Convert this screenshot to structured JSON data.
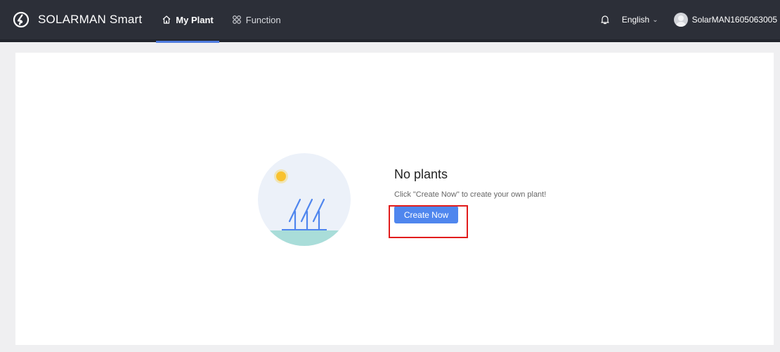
{
  "header": {
    "app_name": "SOLARMAN Smart",
    "logo_icon": "solarman-logo-icon",
    "nav": [
      {
        "label": "My Plant",
        "icon": "home-icon",
        "active": true
      },
      {
        "label": "Function",
        "icon": "grid-icon",
        "active": false
      }
    ],
    "notifications_icon": "bell-icon",
    "language": "English",
    "user": "SolarMAN1605063005"
  },
  "main": {
    "empty_state": {
      "illustration": "solar-panels-illustration",
      "title": "No plants",
      "description": "Click \"Create Now\" to create your own plant!",
      "button_label": "Create Now"
    }
  },
  "colors": {
    "header_bg": "#2c2f38",
    "accent": "#4f86ee",
    "highlight": "#e11c1c"
  }
}
